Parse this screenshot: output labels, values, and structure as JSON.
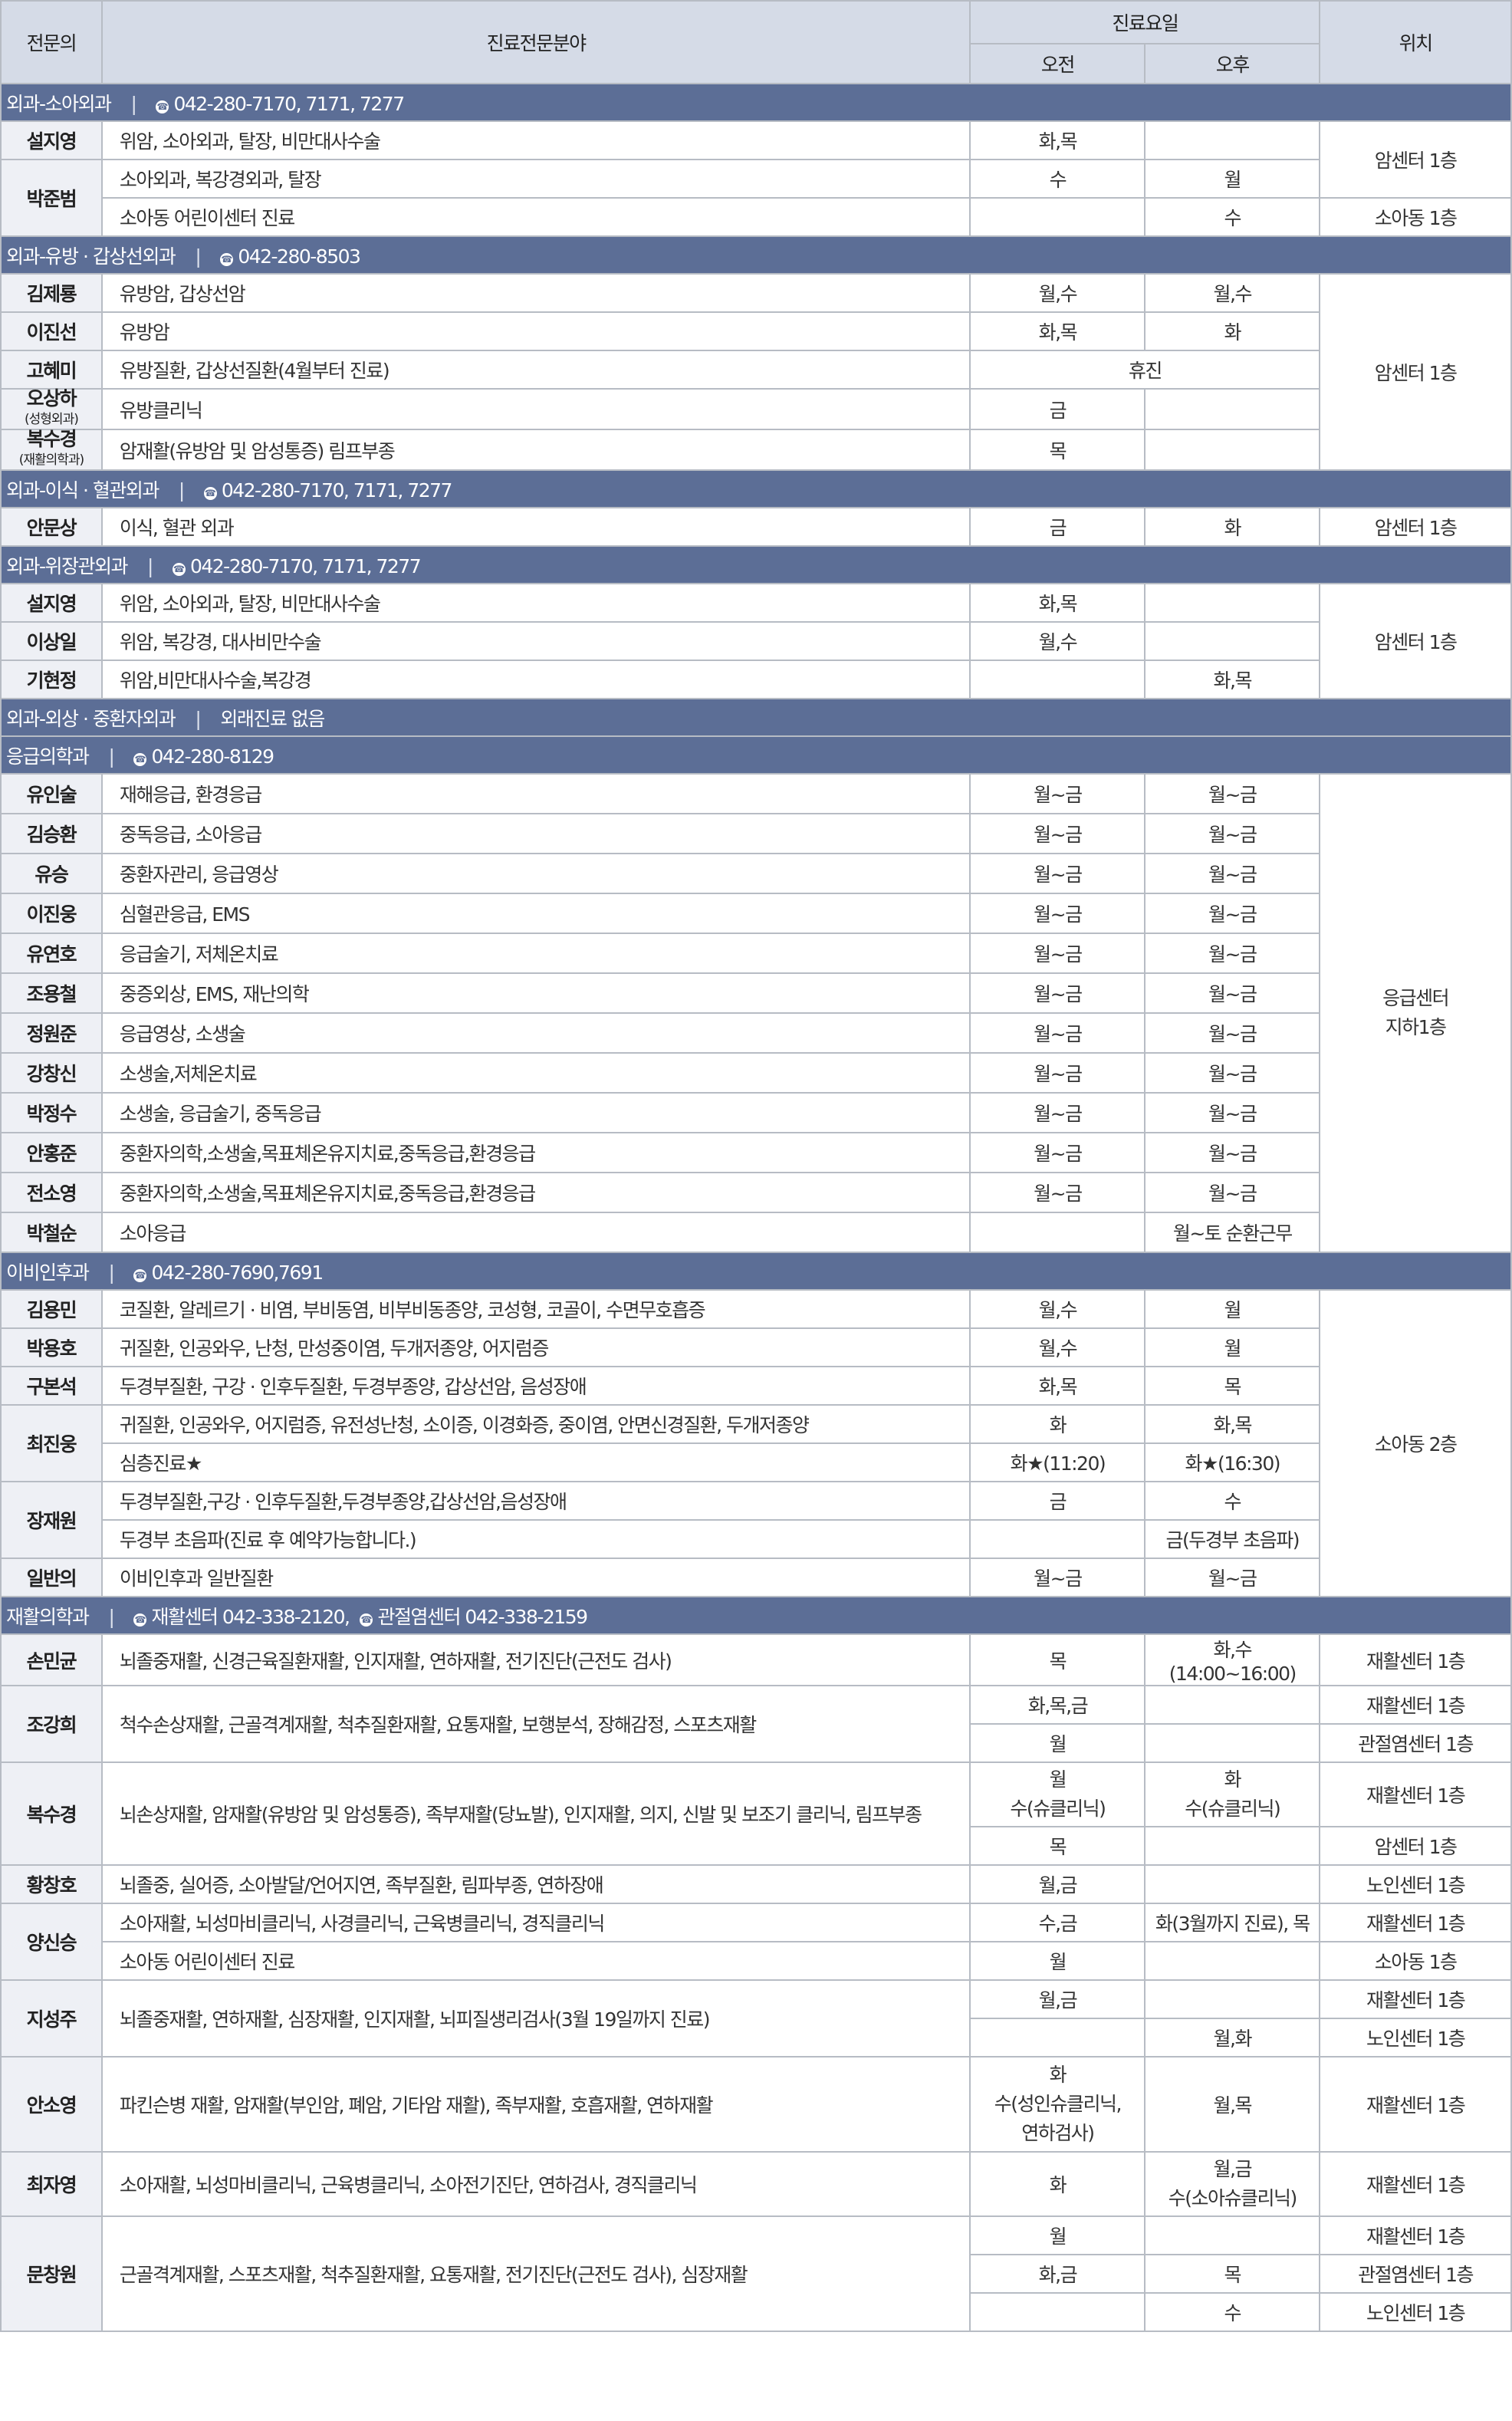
{
  "header": {
    "specialist": "전문의",
    "field": "진료전문분야",
    "schedule": "진료요일",
    "am": "오전",
    "pm": "오후",
    "location": "위치"
  },
  "rows": [
    {
      "type": "dept",
      "name": "외과-소아외과",
      "contacts": [
        "042-280-7170, 7171, 7277"
      ]
    },
    {
      "type": "row",
      "doc": "설지영",
      "docRows": 1,
      "area": "위암, 소아외과, 탈장, 비만대사수술",
      "am": "화,목",
      "pm": "",
      "loc": "암센터 1층",
      "locRows": 2
    },
    {
      "type": "row",
      "doc": "박준범",
      "docRows": 2,
      "area": "소아외과, 복강경외과, 탈장",
      "am": "수",
      "pm": "월"
    },
    {
      "type": "row",
      "area": "소아동 어린이센터 진료",
      "am": "",
      "pm": "수",
      "loc": "소아동 1층"
    },
    {
      "type": "dept",
      "name": "외과-유방 · 갑상선외과",
      "contacts": [
        "042-280-8503"
      ]
    },
    {
      "type": "row",
      "doc": "김제룡",
      "area": "유방암, 갑상선암",
      "am": "월,수",
      "pm": "월,수",
      "loc": "암센터 1층",
      "locRows": 5
    },
    {
      "type": "row",
      "doc": "이진선",
      "area": "유방암",
      "am": "화,목",
      "pm": "화"
    },
    {
      "type": "row",
      "doc": "고혜미",
      "area": "유방질환, 갑상선질환(4월부터 진료)",
      "amSpan": "휴진"
    },
    {
      "type": "row",
      "doc": "오상하",
      "docSub": "(성형외과)",
      "area": "유방클리닉",
      "am": "금",
      "pm": "",
      "tall": true
    },
    {
      "type": "row",
      "doc": "복수경",
      "docSub": "(재활의학과)",
      "area": "암재활(유방암 및 암성통증) 림프부종",
      "am": "목",
      "pm": "",
      "tall": true
    },
    {
      "type": "dept",
      "name": "외과-이식 · 혈관외과",
      "contacts": [
        "042-280-7170, 7171, 7277"
      ]
    },
    {
      "type": "row",
      "doc": "안문상",
      "area": "이식, 혈관 외과",
      "am": "금",
      "pm": "화",
      "loc": "암센터 1층"
    },
    {
      "type": "dept",
      "name": "외과-위장관외과",
      "contacts": [
        "042-280-7170, 7171, 7277"
      ]
    },
    {
      "type": "row",
      "doc": "설지영",
      "area": "위암, 소아외과, 탈장, 비만대사수술",
      "am": "화,목",
      "pm": "",
      "loc": "암센터 1층",
      "locRows": 3
    },
    {
      "type": "row",
      "doc": "이상일",
      "area": "위암, 복강경, 대사비만수술",
      "am": "월,수",
      "pm": ""
    },
    {
      "type": "row",
      "doc": "기현정",
      "area": "위암,비만대사수술,복강경",
      "am": "",
      "pm": "화,목"
    },
    {
      "type": "dept",
      "name": "외과-외상 · 중환자외과",
      "note": "외래진료 없음"
    },
    {
      "type": "dept",
      "name": "응급의학과",
      "contacts": [
        "042-280-8129"
      ]
    },
    {
      "type": "row",
      "doc": "유인술",
      "area": "재해응급, 환경응급",
      "am": "월~금",
      "pm": "월~금",
      "loc": "응급센터\n지하1층",
      "locRows": 12,
      "tall": true
    },
    {
      "type": "row",
      "doc": "김승환",
      "area": "중독응급, 소아응급",
      "am": "월~금",
      "pm": "월~금",
      "tall": true
    },
    {
      "type": "row",
      "doc": "유승",
      "area": "중환자관리, 응급영상",
      "am": "월~금",
      "pm": "월~금",
      "tall": true
    },
    {
      "type": "row",
      "doc": "이진웅",
      "area": "심혈관응급, EMS",
      "am": "월~금",
      "pm": "월~금",
      "tall": true
    },
    {
      "type": "row",
      "doc": "유연호",
      "area": "응급술기, 저체온치료",
      "am": "월~금",
      "pm": "월~금",
      "tall": true
    },
    {
      "type": "row",
      "doc": "조용철",
      "area": "중증외상, EMS, 재난의학",
      "am": "월~금",
      "pm": "월~금",
      "tall": true
    },
    {
      "type": "row",
      "doc": "정원준",
      "area": "응급영상, 소생술",
      "am": "월~금",
      "pm": "월~금",
      "tall": true
    },
    {
      "type": "row",
      "doc": "강창신",
      "area": "소생술,저체온치료",
      "am": "월~금",
      "pm": "월~금",
      "tall": true
    },
    {
      "type": "row",
      "doc": "박정수",
      "area": "소생술, 응급술기, 중독응급",
      "am": "월~금",
      "pm": "월~금",
      "tall": true
    },
    {
      "type": "row",
      "doc": "안홍준",
      "area": "중환자의학,소생술,목표체온유지치료,중독응급,환경응급",
      "am": "월~금",
      "pm": "월~금",
      "tall": true
    },
    {
      "type": "row",
      "doc": "전소영",
      "area": "중환자의학,소생술,목표체온유지치료,중독응급,환경응급",
      "am": "월~금",
      "pm": "월~금",
      "tall": true
    },
    {
      "type": "row",
      "doc": "박철순",
      "area": "소아응급",
      "am": "",
      "pm": "월~토 순환근무",
      "tall": true
    },
    {
      "type": "dept",
      "name": "이비인후과",
      "contacts": [
        "042-280-7690,7691"
      ]
    },
    {
      "type": "row",
      "doc": "김용민",
      "area": "코질환, 알레르기 · 비염, 부비동염, 비부비동종양, 코성형, 코골이, 수면무호흡증",
      "am": "월,수",
      "pm": "월",
      "loc": "소아동 2층",
      "locRows": 8
    },
    {
      "type": "row",
      "doc": "박용호",
      "area": "귀질환, 인공와우, 난청, 만성중이염, 두개저종양, 어지럼증",
      "am": "월,수",
      "pm": "월"
    },
    {
      "type": "row",
      "doc": "구본석",
      "area": "두경부질환, 구강 · 인후두질환, 두경부종양, 갑상선암, 음성장애",
      "am": "화,목",
      "pm": "목"
    },
    {
      "type": "row",
      "doc": "최진웅",
      "docRows": 2,
      "area": "귀질환, 인공와우, 어지럼증, 유전성난청, 소이증, 이경화증, 중이염, 안면신경질환, 두개저종양",
      "am": "화",
      "pm": "화,목"
    },
    {
      "type": "row",
      "area": "심층진료★",
      "am": "화★(11:20)",
      "pm": "화★(16:30)"
    },
    {
      "type": "row",
      "doc": "장재원",
      "docRows": 2,
      "area": "두경부질환,구강 · 인후두질환,두경부종양,갑상선암,음성장애",
      "am": "금",
      "pm": "수"
    },
    {
      "type": "row",
      "area": "두경부 초음파(진료 후 예약가능합니다.)",
      "am": "",
      "pm": "금(두경부 초음파)"
    },
    {
      "type": "row",
      "doc": "일반의",
      "area": "이비인후과 일반질환",
      "am": "월~금",
      "pm": "월~금"
    },
    {
      "type": "dept",
      "name": "재활의학과",
      "contacts": [
        "재활센터 042-338-2120,",
        "관절염센터 042-338-2159"
      ]
    },
    {
      "type": "row",
      "doc": "손민균",
      "area": "뇌졸중재활, 신경근육질환재활, 인지재활, 연하재활, 전기진단(근전도 검사)",
      "am": "목",
      "pm": "화,수(14:00~16:00)",
      "loc": "재활센터 1층"
    },
    {
      "type": "row",
      "doc": "조강희",
      "docRows": 2,
      "area": "척수손상재활, 근골격계재활, 척추질환재활, 요통재활, 보행분석, 장해감정, 스포츠재활",
      "areaRows": 2,
      "am": "화,목,금",
      "pm": "",
      "loc": "재활센터 1층"
    },
    {
      "type": "row",
      "am": "월",
      "pm": "",
      "loc": "관절염센터 1층"
    },
    {
      "type": "row",
      "doc": "복수경",
      "docRows": 2,
      "area": "뇌손상재활, 암재활(유방암 및 암성통증), 족부재활(당뇨발), 인지재활, 의지, 신발 및 보조기 클리닉, 림프부종",
      "areaRows": 2,
      "am": "월\n수(슈클리닉)",
      "pm": "화\n수(슈클리닉)",
      "loc": "재활센터 1층",
      "h": 84
    },
    {
      "type": "row",
      "am": "목",
      "pm": "",
      "loc": "암센터 1층"
    },
    {
      "type": "row",
      "doc": "황창호",
      "area": "뇌졸중, 실어증, 소아발달/언어지연, 족부질환, 림파부종, 연하장애",
      "am": "월,금",
      "pm": "",
      "loc": "노인센터 1층"
    },
    {
      "type": "row",
      "doc": "양신승",
      "docRows": 2,
      "area": "소아재활, 뇌성마비클리닉, 사경클리닉, 근육병클리닉, 경직클리닉",
      "am": "수,금",
      "pm": "화(3월까지 진료), 목",
      "loc": "재활센터 1층"
    },
    {
      "type": "row",
      "area": "소아동 어린이센터 진료",
      "am": "월",
      "pm": "",
      "loc": "소아동 1층"
    },
    {
      "type": "row",
      "doc": "지성주",
      "docRows": 2,
      "area": "뇌졸중재활, 연하재활, 심장재활, 인지재활, 뇌피질생리검사(3월 19일까지 진료)",
      "areaRows": 2,
      "am": "월,금",
      "pm": "",
      "loc": "재활센터 1층"
    },
    {
      "type": "row",
      "am": "",
      "pm": "월,화",
      "loc": "노인센터 1층"
    },
    {
      "type": "row",
      "doc": "안소영",
      "area": "파킨슨병 재활, 암재활(부인암, 폐암, 기타암 재활), 족부재활, 호흡재활, 연하재활",
      "am": "화\n수(성인슈클리닉,\n연하검사)",
      "pm": "월,목",
      "loc": "재활센터 1층",
      "h": 124
    },
    {
      "type": "row",
      "doc": "최자영",
      "area": "소아재활, 뇌성마비클리닉, 근육병클리닉, 소아전기진단, 연하검사, 경직클리닉",
      "am": "화",
      "pm": "월,금\n수(소아슈클리닉)",
      "loc": "재활센터 1층",
      "h": 84
    },
    {
      "type": "row",
      "doc": "문창원",
      "docRows": 3,
      "area": "근골격계재활, 스포츠재활, 척추질환재활, 요통재활, 전기진단(근전도 검사), 심장재활",
      "areaRows": 3,
      "am": "월",
      "pm": "",
      "loc": "재활센터 1층"
    },
    {
      "type": "row",
      "am": "화,금",
      "pm": "목",
      "loc": "관절염센터 1층"
    },
    {
      "type": "row",
      "am": "",
      "pm": "수",
      "loc": "노인센터 1층"
    }
  ]
}
